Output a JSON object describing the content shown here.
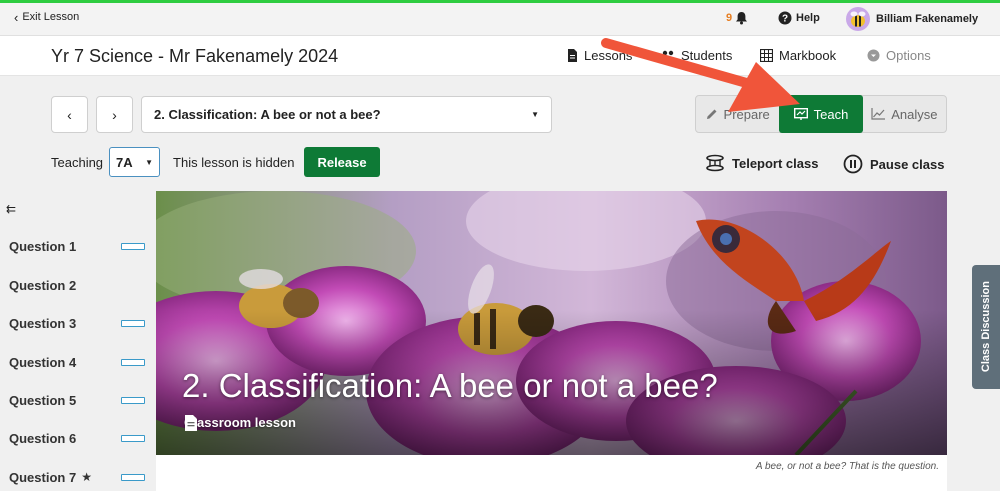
{
  "topbar": {
    "exit_label": "Exit Lesson",
    "notification_count": "9",
    "help_label": "Help",
    "user_name": "Billiam Fakenamely"
  },
  "header": {
    "course_title": "Yr 7 Science - Mr Fakenamely 2024",
    "nav": {
      "lessons": "Lessons",
      "students": "Students",
      "markbook": "Markbook",
      "options": "Options"
    }
  },
  "lesson": {
    "selected": "2. Classification: A bee or not a bee?"
  },
  "modes": {
    "prepare": "Prepare",
    "teach": "Teach",
    "analyse": "Analyse",
    "active": "teach"
  },
  "teaching": {
    "label": "Teaching",
    "class": "7A",
    "hidden_text": "This lesson is hidden",
    "release_label": "Release"
  },
  "actions": {
    "teleport": "Teleport class",
    "pause": "Pause class"
  },
  "sidebar": {
    "questions": [
      {
        "label": "Question 1",
        "progress_bar": true,
        "starred": false
      },
      {
        "label": "Question 2",
        "progress_bar": false,
        "starred": false
      },
      {
        "label": "Question 3",
        "progress_bar": true,
        "starred": false
      },
      {
        "label": "Question 4",
        "progress_bar": true,
        "starred": false
      },
      {
        "label": "Question 5",
        "progress_bar": true,
        "starred": false
      },
      {
        "label": "Question 6",
        "progress_bar": true,
        "starred": false
      },
      {
        "label": "Question 7",
        "progress_bar": true,
        "starred": true
      }
    ]
  },
  "hero": {
    "title": "2. Classification: A bee or not a bee?",
    "subtitle": "Classroom lesson",
    "caption": "A bee, or not a bee? That is the question."
  },
  "side_tab": {
    "label": "Class Discussion"
  },
  "colors": {
    "accent_green": "#0e7a36",
    "top_stripe": "#2ecc40",
    "annotation_arrow": "#f0553a",
    "progress_outline": "#3a9ac9"
  }
}
